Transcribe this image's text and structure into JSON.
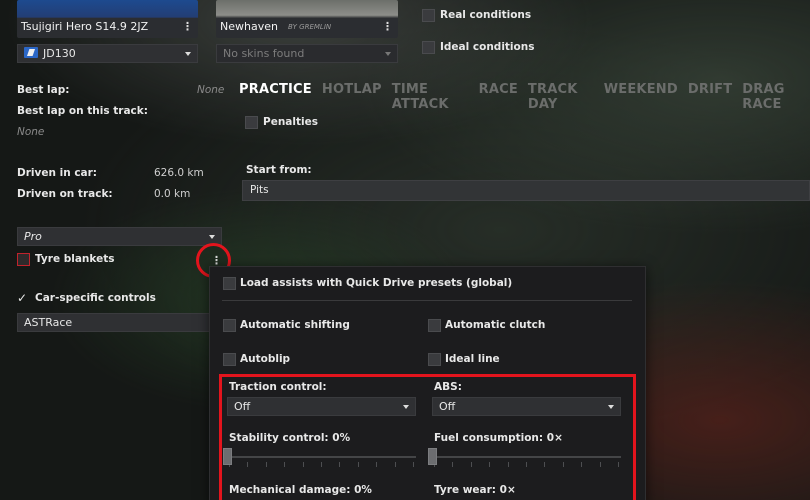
{
  "car": {
    "name": "Tsujigiri Hero S14.9 2JZ",
    "skin": "JD130"
  },
  "track": {
    "name": "Newhaven",
    "watermark": "BY GREMLIN",
    "skin_placeholder": "No skins found"
  },
  "conditions": {
    "real": "Real conditions",
    "ideal": "Ideal conditions"
  },
  "stats": {
    "best_lap_label": "Best lap:",
    "best_lap_value": "None",
    "best_lap_track_label": "Best lap on this track:",
    "best_lap_track_value": "None",
    "driven_car_label": "Driven in car:",
    "driven_car_value": "626.0 km",
    "driven_track_label": "Driven on track:",
    "driven_track_value": "0.0 km"
  },
  "difficulty": {
    "selected": "Pro"
  },
  "tyre_blankets": {
    "label": "Tyre blankets",
    "checked": false
  },
  "car_specific_controls": {
    "label": "Car-specific controls",
    "checked": true,
    "preset": "ASTRace"
  },
  "menu_glyph": "⋮",
  "modes": {
    "tabs": [
      "PRACTICE",
      "HOTLAP",
      "TIME ATTACK",
      "RACE",
      "TRACK DAY",
      "WEEKEND",
      "DRIFT",
      "DRAG RACE"
    ],
    "active": "PRACTICE"
  },
  "practice": {
    "penalties_label": "Penalties",
    "start_from_label": "Start from:",
    "start_from_value": "Pits"
  },
  "assists": {
    "load_presets": "Load assists with Quick Drive presets (global)",
    "automatic_shifting": "Automatic shifting",
    "automatic_clutch": "Automatic clutch",
    "autoblip": "Autoblip",
    "ideal_line": "Ideal line",
    "traction_control_label": "Traction control:",
    "traction_control_value": "Off",
    "abs_label": "ABS:",
    "abs_value": "Off",
    "stability_control_label": "Stability control: 0%",
    "stability_control_value": 0,
    "fuel_consumption_label": "Fuel consumption: 0×",
    "fuel_consumption_value": 0,
    "mechanical_damage_label": "Mechanical damage: 0%",
    "tyre_wear_label": "Tyre wear: 0×"
  },
  "colors": {
    "accent_red": "#e3141d",
    "car_badge": "#2b67c7"
  }
}
